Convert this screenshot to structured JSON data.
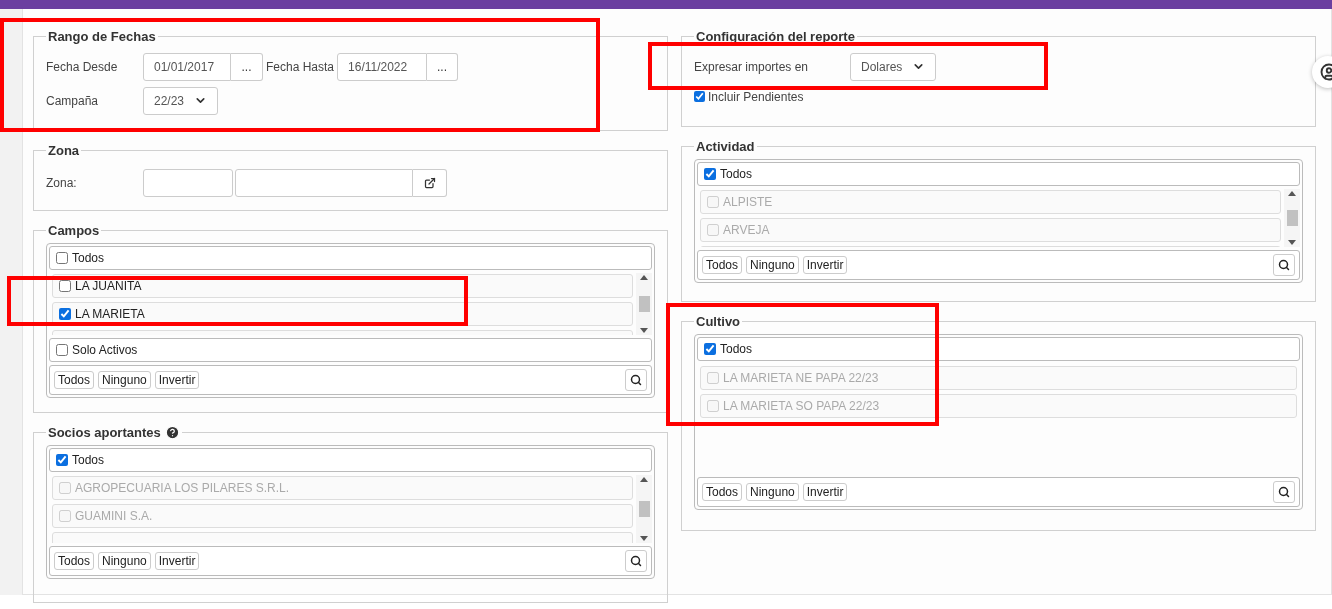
{
  "date_range": {
    "title": "Rango de Fechas",
    "from_label": "Fecha Desde",
    "from_value": "01/01/2017",
    "from_button": "...",
    "to_label": "Fecha Hasta",
    "to_value": "16/11/2022",
    "to_button": "...",
    "season_label": "Campaña",
    "season_value": "22/23"
  },
  "zone": {
    "title": "Zona",
    "label": "Zona:"
  },
  "fields": {
    "title": "Campos",
    "all": {
      "label": "Todos",
      "checked": false
    },
    "scrollable": true,
    "items": [
      {
        "label": "LA JUANITA",
        "checked": false,
        "disabled": false
      },
      {
        "label": "LA MARIETA",
        "checked": true,
        "disabled": false
      }
    ],
    "extra": {
      "label": "Solo Activos",
      "checked": false
    },
    "buttons": [
      "Todos",
      "Ninguno",
      "Invertir"
    ]
  },
  "partners": {
    "title": "Socios aportantes",
    "help": true,
    "all": {
      "label": "Todos",
      "checked": true
    },
    "scrollable": true,
    "items": [
      {
        "label": "AGROPECUARIA LOS PILARES S.R.L.",
        "checked": false,
        "disabled": true
      },
      {
        "label": "GUAMINI S.A.",
        "checked": false,
        "disabled": true
      }
    ],
    "buttons": [
      "Todos",
      "Ninguno",
      "Invertir"
    ]
  },
  "report_config": {
    "title": "Configuración del reporte",
    "currency_label": "Expresar importes en",
    "currency_value": "Dolares",
    "pending": {
      "label": "Incluir Pendientes",
      "checked": true
    }
  },
  "activity": {
    "title": "Actividad",
    "all": {
      "label": "Todos",
      "checked": true
    },
    "scrollable": true,
    "items": [
      {
        "label": "ALPISTE",
        "checked": false,
        "disabled": true
      },
      {
        "label": "ARVEJA",
        "checked": false,
        "disabled": true
      }
    ],
    "buttons": [
      "Todos",
      "Ninguno",
      "Invertir"
    ]
  },
  "crop": {
    "title": "Cultivo",
    "all": {
      "label": "Todos",
      "checked": true
    },
    "scrollable": false,
    "items": [
      {
        "label": "LA MARIETA NE PAPA 22/23",
        "checked": false,
        "disabled": true
      },
      {
        "label": "LA MARIETA SO PAPA 22/23",
        "checked": false,
        "disabled": true
      }
    ],
    "buttons": [
      "Todos",
      "Ninguno",
      "Invertir"
    ]
  }
}
